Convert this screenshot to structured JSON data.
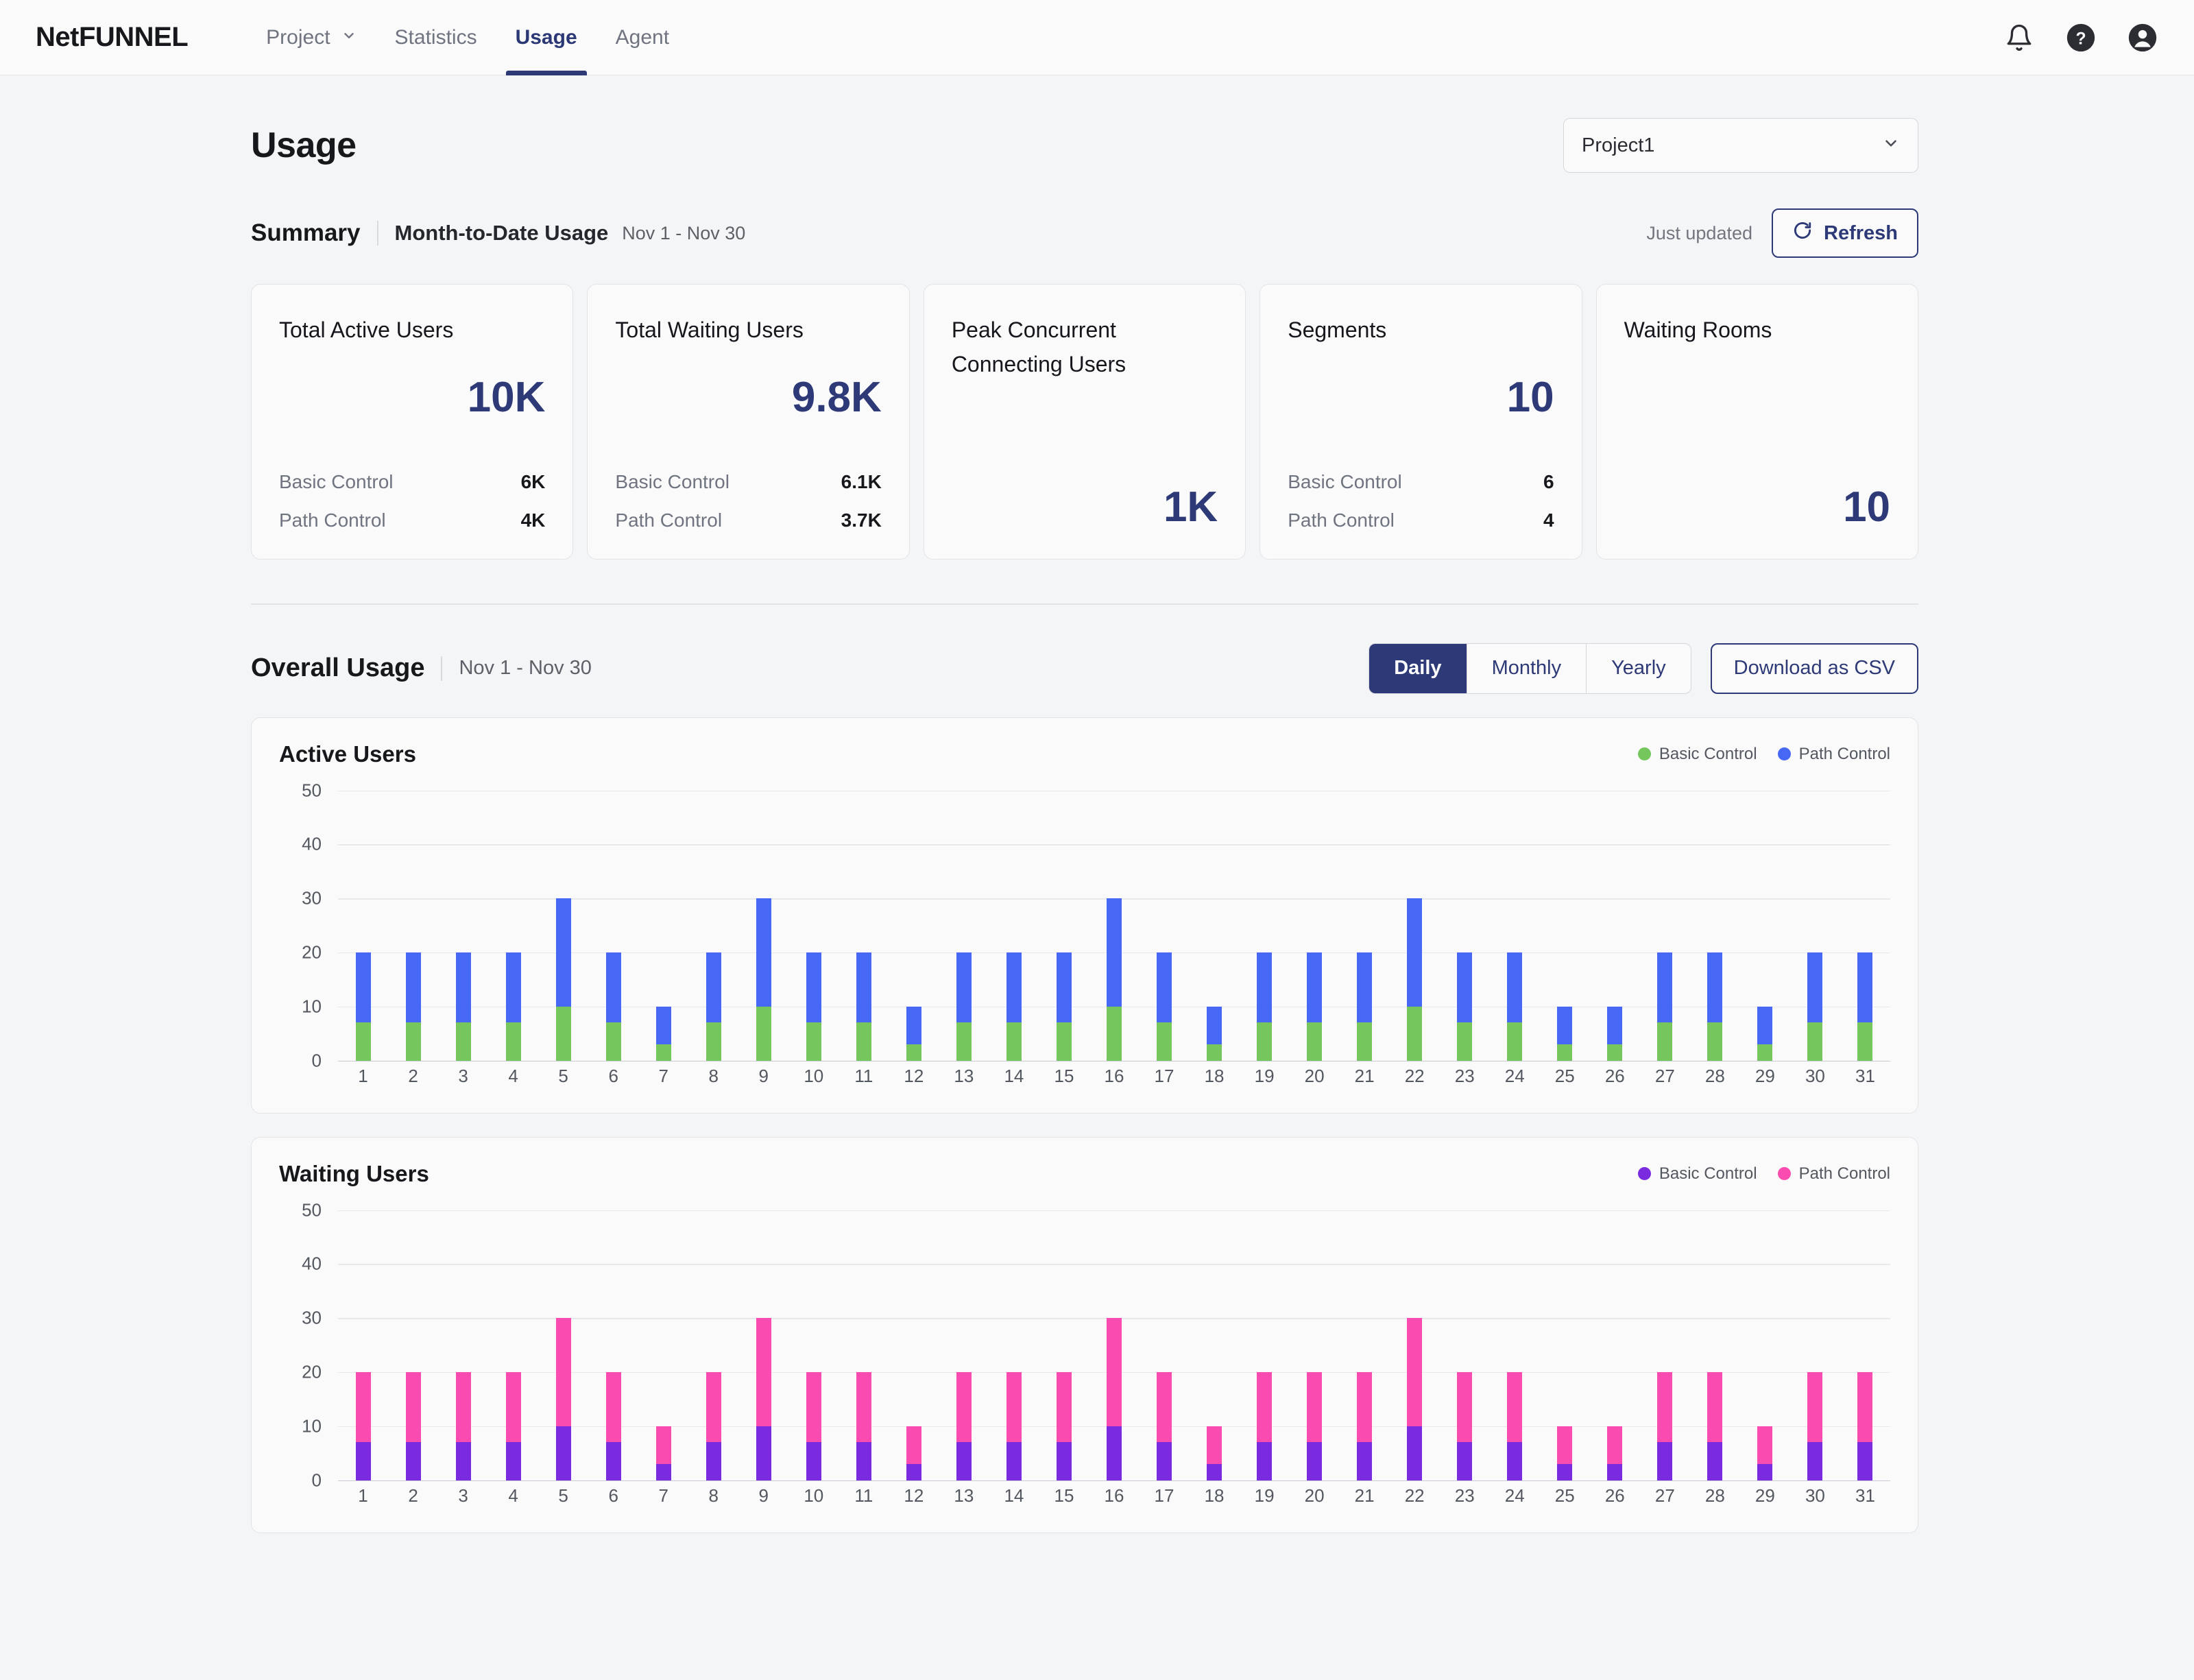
{
  "nav": {
    "brand": "NetFUNNEL",
    "items": [
      {
        "label": "Project",
        "caret": "chevron-down-icon",
        "active": false
      },
      {
        "label": "Statistics",
        "active": false
      },
      {
        "label": "Usage",
        "active": true
      },
      {
        "label": "Agent",
        "active": false
      }
    ],
    "icons": [
      "bell-icon",
      "help-icon",
      "account-icon"
    ]
  },
  "header": {
    "title": "Usage",
    "project_selected": "Project1"
  },
  "summary": {
    "title": "Summary",
    "subtitle": "Month-to-Date Usage",
    "range": "Nov 1 - Nov 30",
    "updated_label": "Just updated",
    "refresh_label": "Refresh",
    "cards": [
      {
        "title": "Total Active Users",
        "big": "10K",
        "rows": [
          {
            "label": "Basic Control",
            "value": "6K"
          },
          {
            "label": "Path Control",
            "value": "4K"
          }
        ]
      },
      {
        "title": "Total Waiting Users",
        "big": "9.8K",
        "rows": [
          {
            "label": "Basic Control",
            "value": "6.1K"
          },
          {
            "label": "Path Control",
            "value": "3.7K"
          }
        ]
      },
      {
        "title": "Peak Concurrent Connecting Users",
        "big": "1K",
        "rows": []
      },
      {
        "title": "Segments",
        "big": "10",
        "rows": [
          {
            "label": "Basic Control",
            "value": "6"
          },
          {
            "label": "Path Control",
            "value": "4"
          }
        ]
      },
      {
        "title": "Waiting Rooms",
        "big": "10",
        "rows": []
      }
    ]
  },
  "overall": {
    "title": "Overall Usage",
    "range": "Nov 1 - Nov 30",
    "periods": [
      {
        "label": "Daily",
        "active": true
      },
      {
        "label": "Monthly",
        "active": false
      },
      {
        "label": "Yearly",
        "active": false
      }
    ],
    "download_label": "Download as CSV"
  },
  "colors": {
    "accent": "#2e3a77",
    "active_basic": "#75c65c",
    "active_path": "#4768f5",
    "waiting_basic": "#7a2be0",
    "waiting_path": "#fa4bb0"
  },
  "chart_data": [
    {
      "type": "bar",
      "title": "Active Users",
      "stacked": true,
      "xlabel": "",
      "ylabel": "",
      "ylim": [
        0,
        50
      ],
      "yticks": [
        0,
        10,
        20,
        30,
        40,
        50
      ],
      "grid": true,
      "legend_position": "top-right",
      "categories": [
        "1",
        "2",
        "3",
        "4",
        "5",
        "6",
        "7",
        "8",
        "9",
        "10",
        "11",
        "12",
        "13",
        "14",
        "15",
        "16",
        "17",
        "18",
        "19",
        "20",
        "21",
        "22",
        "23",
        "24",
        "25",
        "26",
        "27",
        "28",
        "29",
        "30",
        "31"
      ],
      "series": [
        {
          "name": "Basic Control",
          "color": "#75c65c",
          "values": [
            7,
            7,
            7,
            7,
            10,
            7,
            3,
            7,
            10,
            7,
            7,
            3,
            7,
            7,
            7,
            10,
            7,
            3,
            7,
            7,
            7,
            10,
            7,
            7,
            3,
            3,
            7,
            7,
            3,
            7,
            7
          ]
        },
        {
          "name": "Path Control",
          "color": "#4768f5",
          "values": [
            13,
            13,
            13,
            13,
            20,
            13,
            7,
            13,
            20,
            13,
            13,
            7,
            13,
            13,
            13,
            20,
            13,
            7,
            13,
            13,
            13,
            20,
            13,
            13,
            7,
            7,
            13,
            13,
            7,
            13,
            13
          ]
        }
      ],
      "totals": [
        20,
        20,
        20,
        20,
        30,
        20,
        10,
        20,
        30,
        20,
        20,
        10,
        20,
        20,
        20,
        30,
        20,
        10,
        20,
        20,
        20,
        30,
        20,
        20,
        10,
        10,
        20,
        20,
        10,
        20,
        20
      ]
    },
    {
      "type": "bar",
      "title": "Waiting Users",
      "stacked": true,
      "xlabel": "",
      "ylabel": "",
      "ylim": [
        0,
        50
      ],
      "yticks": [
        0,
        10,
        20,
        30,
        40,
        50
      ],
      "grid": true,
      "legend_position": "top-right",
      "categories": [
        "1",
        "2",
        "3",
        "4",
        "5",
        "6",
        "7",
        "8",
        "9",
        "10",
        "11",
        "12",
        "13",
        "14",
        "15",
        "16",
        "17",
        "18",
        "19",
        "20",
        "21",
        "22",
        "23",
        "24",
        "25",
        "26",
        "27",
        "28",
        "29",
        "30",
        "31"
      ],
      "series": [
        {
          "name": "Basic Control",
          "color": "#7a2be0",
          "values": [
            7,
            7,
            7,
            7,
            10,
            7,
            3,
            7,
            10,
            7,
            7,
            3,
            7,
            7,
            7,
            10,
            7,
            3,
            7,
            7,
            7,
            10,
            7,
            7,
            3,
            3,
            7,
            7,
            3,
            7,
            7
          ]
        },
        {
          "name": "Path Control",
          "color": "#fa4bb0",
          "values": [
            13,
            13,
            13,
            13,
            20,
            13,
            7,
            13,
            20,
            13,
            13,
            7,
            13,
            13,
            13,
            20,
            13,
            7,
            13,
            13,
            13,
            20,
            13,
            13,
            7,
            7,
            13,
            13,
            7,
            13,
            13
          ]
        }
      ],
      "totals": [
        20,
        20,
        20,
        20,
        30,
        20,
        10,
        20,
        30,
        20,
        20,
        10,
        20,
        20,
        20,
        30,
        20,
        10,
        20,
        20,
        20,
        30,
        20,
        20,
        10,
        10,
        20,
        20,
        10,
        20,
        20
      ]
    }
  ]
}
